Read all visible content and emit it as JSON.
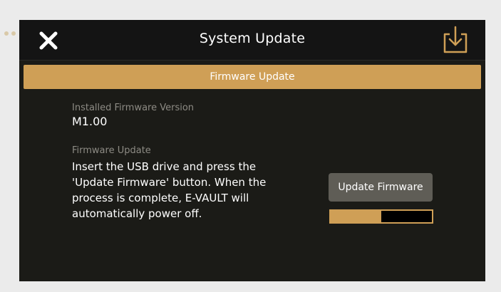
{
  "window": {
    "title": "System Update"
  },
  "icons": {
    "close": "close-icon",
    "download": "download-tray-icon"
  },
  "section": {
    "label": "Firmware Update"
  },
  "installed": {
    "label": "Installed Firmware Version",
    "value": "M1.00"
  },
  "update": {
    "label": "Firmware Update",
    "instructions": "Insert the USB drive and press the 'Update Firmware' button. When the process is complete, E-VAULT will automatically power off.",
    "button_label": "Update Firmware",
    "progress_fraction": 0.5
  },
  "colors": {
    "accent": "#cf9f56",
    "background": "#1b1b17",
    "button": "#5f5d56"
  }
}
